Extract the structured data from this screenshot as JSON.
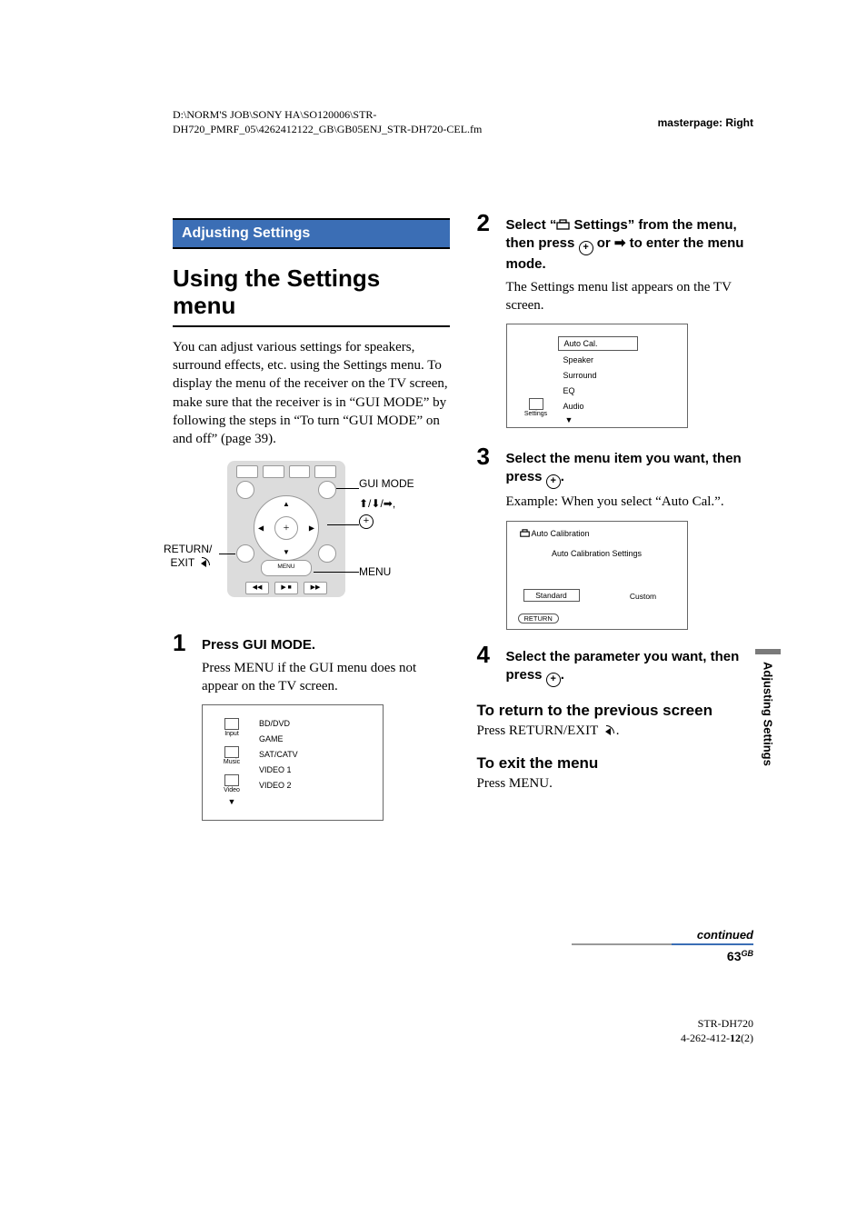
{
  "header": {
    "path_line1": "D:\\NORM'S JOB\\SONY HA\\SO120006\\STR-",
    "path_line2": "DH720_PMRF_05\\4262412122_GB\\GB05ENJ_STR-DH720-CEL.fm",
    "masterpage": "masterpage: Right"
  },
  "section_bar": "Adjusting Settings",
  "title": "Using the Settings menu",
  "intro": "You can adjust various settings for speakers, surround effects, etc. using the Settings menu. To display the menu of the receiver on the TV screen, make sure that the receiver is in “GUI MODE” by following the steps in “To turn “GUI MODE” on and off” (page 39).",
  "remote_callouts": {
    "left": "RETURN/\nEXIT 🔙",
    "menu": "MENU",
    "gui": "GUI MODE",
    "arrows": "⬆/⬇/➡,",
    "menu_btn": "MENU"
  },
  "step1": {
    "num": "1",
    "heading": "Press GUI MODE.",
    "body": "Press MENU if the GUI menu does not appear on the TV screen."
  },
  "screen1": {
    "sidebar": [
      {
        "icon": "input-icon",
        "label": "Input"
      },
      {
        "icon": "music-icon",
        "label": "Music"
      },
      {
        "icon": "video-icon",
        "label": "Video"
      }
    ],
    "list": [
      "BD/DVD",
      "GAME",
      "SAT/CATV",
      "VIDEO 1",
      "VIDEO 2"
    ]
  },
  "step2": {
    "num": "2",
    "heading_prefix": "Select “",
    "heading_suffix": " Settings” from the menu, then press ",
    "heading_tail": " or ➡ to enter the menu mode.",
    "body": "The Settings menu list appears on the TV screen."
  },
  "screen2": {
    "sidebar_icon_label": "Settings",
    "list": [
      "Auto Cal.",
      "Speaker",
      "Surround",
      "EQ",
      "Audio"
    ]
  },
  "step3": {
    "num": "3",
    "heading_prefix": "Select the menu item you want, then press ",
    "heading_suffix": ".",
    "body": "Example: When you select “Auto Cal.”."
  },
  "screen3": {
    "title_prefix": "Auto Calibration",
    "subtitle": "Auto Calibration Settings",
    "left_btn": "Standard",
    "right_btn": "Custom",
    "return": "RETURN"
  },
  "step4": {
    "num": "4",
    "heading_prefix": "Select the parameter you want, then press ",
    "heading_suffix": "."
  },
  "sub_return": {
    "head": "To return to the previous screen",
    "body_prefix": "Press RETURN/EXIT ",
    "body_suffix": "."
  },
  "sub_exit": {
    "head": "To exit the menu",
    "body": "Press MENU."
  },
  "sidebar_tab": "Adjusting Settings",
  "continued": "continued",
  "page_num": "63",
  "page_loc": "GB",
  "footer": {
    "model": "STR-DH720",
    "doc_prefix": "4-262-412-",
    "doc_bold": "12",
    "doc_suffix": "(2)"
  }
}
